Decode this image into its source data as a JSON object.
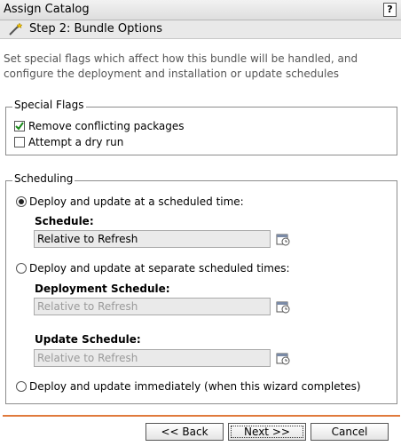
{
  "window": {
    "title": "Assign Catalog",
    "help_label": "?"
  },
  "step": {
    "title": "Step 2: Bundle Options",
    "icon": "wizard-wand-icon"
  },
  "intro_text": "Set special flags which affect how this bundle will be handled, and configure the deployment and installation or update schedules",
  "special_flags": {
    "legend": "Special Flags",
    "items": [
      {
        "label": "Remove conflicting packages",
        "checked": true
      },
      {
        "label": "Attempt a dry run",
        "checked": false
      }
    ]
  },
  "scheduling": {
    "legend": "Scheduling",
    "option_scheduled": {
      "label": "Deploy and update at a scheduled time:",
      "selected": true
    },
    "schedule_label": "Schedule:",
    "schedule_value": "Relative to Refresh",
    "option_separate": {
      "label": "Deploy and update at separate scheduled times:",
      "selected": false
    },
    "deployment_schedule_label": "Deployment Schedule:",
    "deployment_schedule_value": "Relative to Refresh",
    "update_schedule_label": "Update Schedule:",
    "update_schedule_value": "Relative to Refresh",
    "option_immediate": {
      "label": "Deploy and update immediately (when this wizard completes)",
      "selected": false
    }
  },
  "buttons": {
    "back": "<< Back",
    "next": "Next >>",
    "cancel": "Cancel"
  },
  "colors": {
    "divider": "#e07a3c"
  }
}
